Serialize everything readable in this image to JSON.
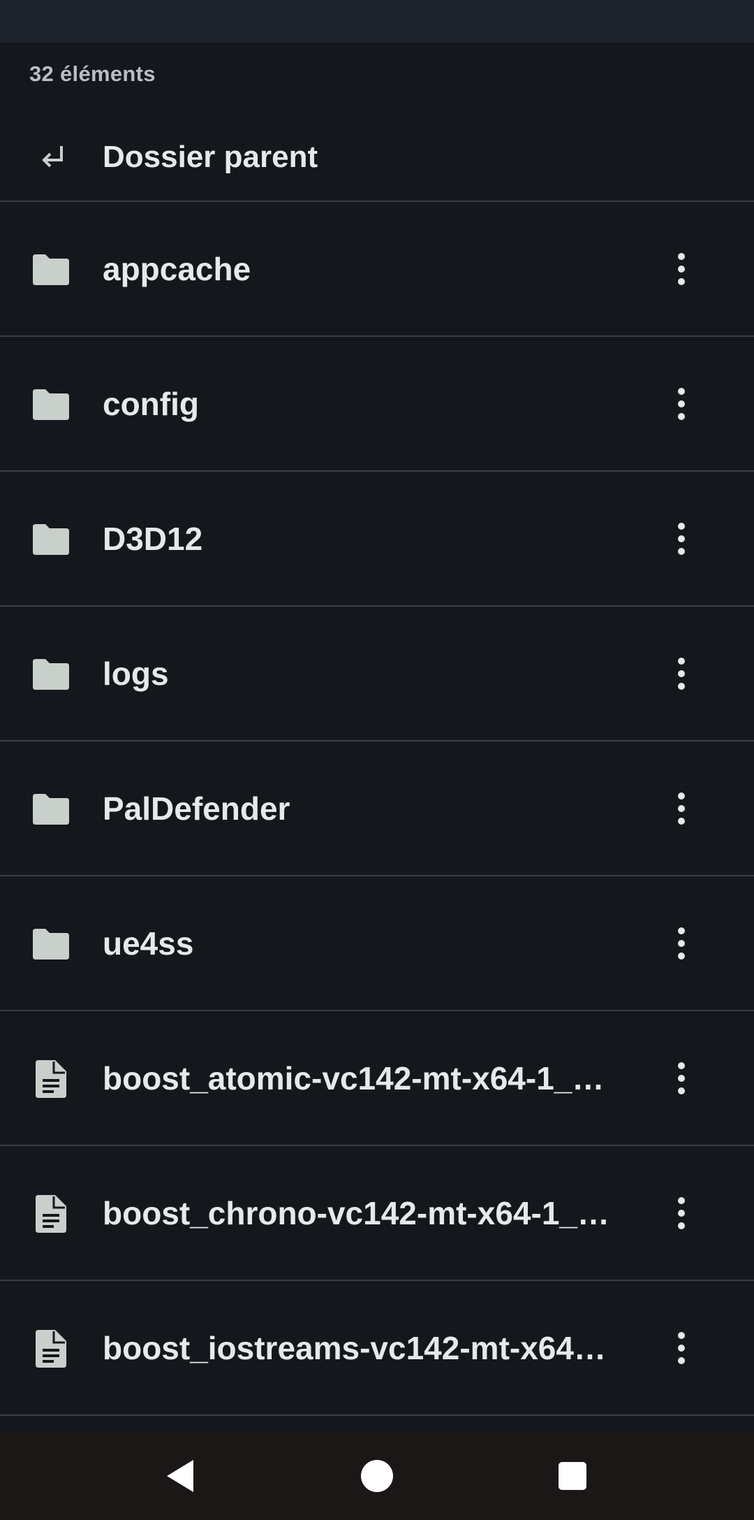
{
  "header": {
    "item_count": "32 éléments"
  },
  "parent": {
    "label": "Dossier parent",
    "icon": "return-arrow-icon"
  },
  "items": [
    {
      "name": "appcache",
      "type": "folder",
      "icon": "folder-icon"
    },
    {
      "name": "config",
      "type": "folder",
      "icon": "folder-icon"
    },
    {
      "name": "D3D12",
      "type": "folder",
      "icon": "folder-icon"
    },
    {
      "name": "logs",
      "type": "folder",
      "icon": "folder-icon"
    },
    {
      "name": "PalDefender",
      "type": "folder",
      "icon": "folder-icon"
    },
    {
      "name": "ue4ss",
      "type": "folder",
      "icon": "folder-icon"
    },
    {
      "name": "boost_atomic-vc142-mt-x64-1_…",
      "type": "file",
      "icon": "file-icon"
    },
    {
      "name": "boost_chrono-vc142-mt-x64-1_…",
      "type": "file",
      "icon": "file-icon"
    },
    {
      "name": "boost_iostreams-vc142-mt-x64…",
      "type": "file",
      "icon": "file-icon"
    }
  ],
  "navigation": {
    "back": "back-triangle-icon",
    "home": "home-circle-icon",
    "recents": "recents-square-icon"
  },
  "colors": {
    "background": "#14171c",
    "header_strip": "#1f242c",
    "divider": "#3a3f46",
    "icon": "#c9cfca",
    "text": "#e6e8ea",
    "nav_bar": "#1b1716"
  }
}
